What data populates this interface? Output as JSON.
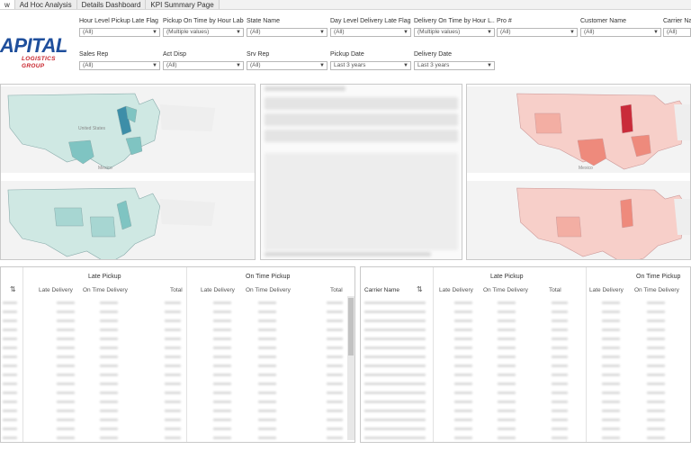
{
  "tabs": [
    "w",
    "Ad Hoc Analysis",
    "Details Dashboard",
    "KPI Summary Page"
  ],
  "logo": {
    "main": "APITAL",
    "sub": "LOGISTICS GROUP"
  },
  "filters": [
    {
      "label": "Hour Level Pickup Late Flag",
      "value": "(All)"
    },
    {
      "label": "Pickup On Time by Hour Label",
      "value": "(Multiple values)"
    },
    {
      "label": "State Name",
      "value": "(All)"
    },
    {
      "label": "Day Level Delivery Late Flag",
      "value": "(All)"
    },
    {
      "label": "Delivery On Time by Hour L...",
      "value": "(Multiple values)"
    },
    {
      "label": "Pro #",
      "value": "(All)"
    },
    {
      "label": "Customer Name",
      "value": "(All)"
    },
    {
      "label": "Carrier Nam",
      "value": "(All)"
    },
    {
      "label": "Sales Rep",
      "value": "(All)"
    },
    {
      "label": "Act Disp",
      "value": "(All)"
    },
    {
      "label": "Srv Rep",
      "value": "(All)"
    },
    {
      "label": "Pickup Date",
      "value": "Last 3 years"
    },
    {
      "label": "Delivery Date",
      "value": "Last 3 years"
    }
  ],
  "maps": {
    "country_label": "United States",
    "mexico_label": "Mexico"
  },
  "left_table": {
    "groups": [
      "Late Pickup",
      "On Time Pickup"
    ],
    "columns": [
      "Late Delivery",
      "On Time Delivery",
      "Total",
      "Late Delivery",
      "On Time Delivery",
      "Total"
    ]
  },
  "right_table": {
    "row_header": "Carrier Name",
    "groups": [
      "Late Pickup",
      "On Time Pickup"
    ],
    "columns": [
      "Late Delivery",
      "On Time Delivery",
      "Total",
      "Late Delivery",
      "On Time Delivery"
    ]
  },
  "colors": {
    "teal_light": "#cfe8e3",
    "teal_mid": "#7fc4c2",
    "teal_dark": "#3d8ea8",
    "red_light": "#f7cfc9",
    "red_mid": "#ee8a7c",
    "red_dark": "#c92b3a",
    "logo_blue": "#1f4f9c"
  }
}
